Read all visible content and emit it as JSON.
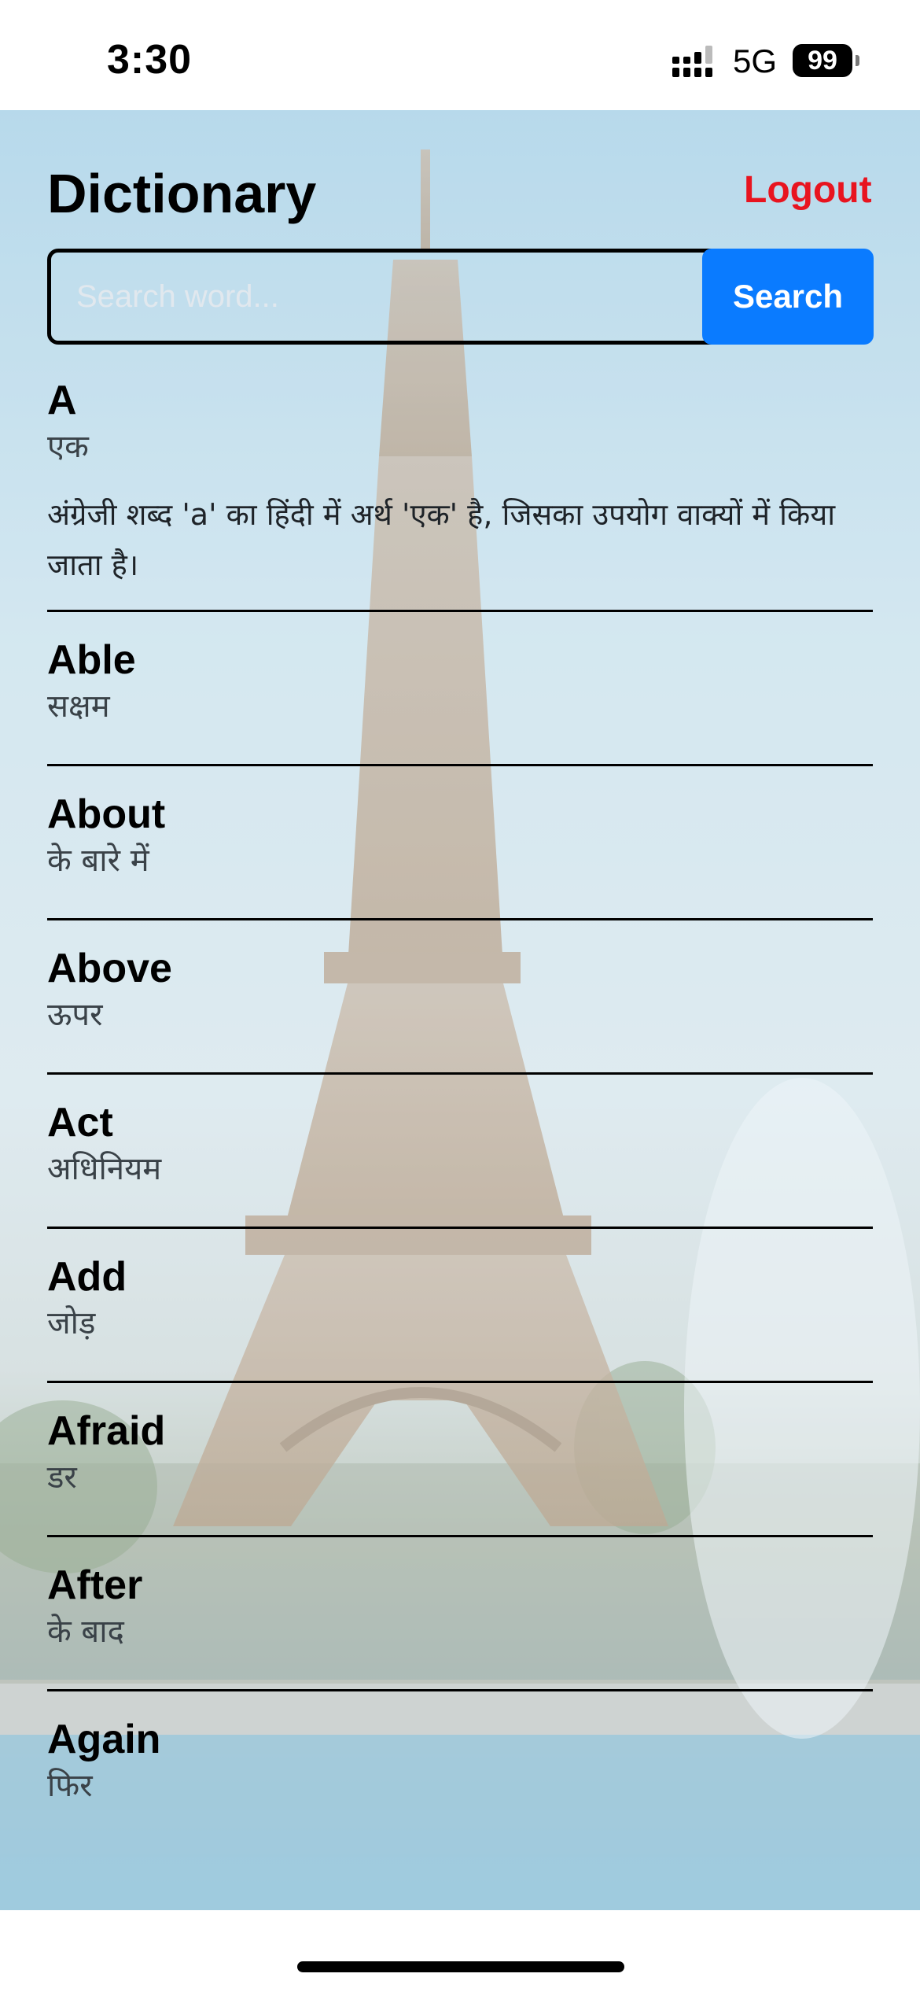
{
  "status_bar": {
    "time": "3:30",
    "network": "5G",
    "battery": "99"
  },
  "header": {
    "title": "Dictionary",
    "logout_label": "Logout"
  },
  "search": {
    "placeholder": "Search word...",
    "value": "",
    "button_label": "Search"
  },
  "words": [
    {
      "word": "A",
      "meaning": "एक",
      "description": "अंग्रेजी शब्द 'a' का हिंदी में अर्थ 'एक' है, जिसका उपयोग वाक्यों में किया जाता है।"
    },
    {
      "word": "Able",
      "meaning": "सक्षम"
    },
    {
      "word": "About",
      "meaning": "के बारे में"
    },
    {
      "word": "Above",
      "meaning": "ऊपर"
    },
    {
      "word": "Act",
      "meaning": "अधिनियम"
    },
    {
      "word": "Add",
      "meaning": "जोड़"
    },
    {
      "word": "Afraid",
      "meaning": "डर"
    },
    {
      "word": "After",
      "meaning": "के बाद"
    },
    {
      "word": "Again",
      "meaning": "फिर"
    }
  ],
  "colors": {
    "accent": "#0a7bff",
    "logout": "#e8141f",
    "divider": "#000000"
  },
  "background": {
    "subject": "eiffel-tower-photo"
  }
}
